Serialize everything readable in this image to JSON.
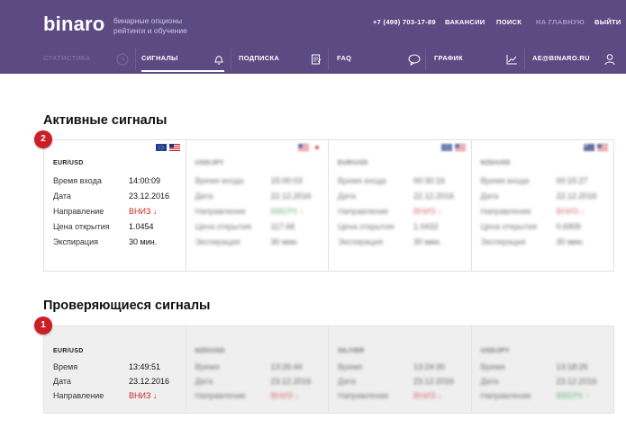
{
  "header": {
    "logo": "binaro",
    "tagline": "бинарные опционы рейтинги и обучение",
    "phone": "+7 (499) 703-17-89",
    "vacancies": "ВАКАНСИИ",
    "search": "ПОИСК",
    "home": "НА ГЛАВНУЮ",
    "logout": "ВЫЙТИ"
  },
  "nav": {
    "stats": "СТАТИСТИКА",
    "signals": "СИГНАЛЫ",
    "subscription": "ПОДПИСКА",
    "faq": "FAQ",
    "chart": "ГРАФИК",
    "user": "AE@BINARO.RU"
  },
  "active": {
    "title": "Активные сигналы",
    "badge": "2",
    "cards": [
      {
        "pair": "EUR/USD",
        "flags": [
          "eu",
          "us"
        ],
        "rows": [
          [
            "Время входа",
            "14:00:09",
            ""
          ],
          [
            "Дата",
            "23.12.2016",
            ""
          ],
          [
            "Направление",
            "ВНИЗ ↓",
            "down"
          ],
          [
            "Цена открытия",
            "1.0454",
            ""
          ],
          [
            "Экспирация",
            "30 мин.",
            ""
          ]
        ]
      },
      {
        "pair": "USD/JPY",
        "flags": [
          "us",
          "jp"
        ],
        "rows": [
          [
            "Время входа",
            "15:00:03",
            ""
          ],
          [
            "Дата",
            "22.12.2016",
            ""
          ],
          [
            "Направление",
            "ВВЕРХ ↑",
            "up"
          ],
          [
            "Цена открытия",
            "117.66",
            ""
          ],
          [
            "Экспирация",
            "30 мин.",
            ""
          ]
        ]
      },
      {
        "pair": "EUR/USD",
        "flags": [
          "eu",
          "us"
        ],
        "rows": [
          [
            "Время входа",
            "00:30:16",
            ""
          ],
          [
            "Дата",
            "22.12.2016",
            ""
          ],
          [
            "Направление",
            "ВНИЗ ↓",
            "down"
          ],
          [
            "Цена открытия",
            "1.0432",
            ""
          ],
          [
            "Экспирация",
            "30 мин.",
            ""
          ]
        ]
      },
      {
        "pair": "NZD/USD",
        "flags": [
          "nz",
          "us"
        ],
        "rows": [
          [
            "Время входа",
            "00:15:27",
            ""
          ],
          [
            "Дата",
            "22.12.2016",
            ""
          ],
          [
            "Направление",
            "ВНИЗ ↓",
            "down"
          ],
          [
            "Цена открытия",
            "0.6905",
            ""
          ],
          [
            "Экспирация",
            "30 мин.",
            ""
          ]
        ]
      }
    ]
  },
  "checking": {
    "title": "Проверяющиеся сигналы",
    "badge": "1",
    "cards": [
      {
        "pair": "EUR/USD",
        "rows": [
          [
            "Время",
            "13:49:51",
            ""
          ],
          [
            "Дата",
            "23.12.2016",
            ""
          ],
          [
            "Направление",
            "ВНИЗ ↓",
            "down"
          ]
        ]
      },
      {
        "pair": "NZD/USD",
        "rows": [
          [
            "Время",
            "13:26:44",
            ""
          ],
          [
            "Дата",
            "23.12.2016",
            ""
          ],
          [
            "Направление",
            "ВНИЗ ↓",
            "down"
          ]
        ]
      },
      {
        "pair": "SIL/VER",
        "rows": [
          [
            "Время",
            "13:24:30",
            ""
          ],
          [
            "Дата",
            "23.12.2016",
            ""
          ],
          [
            "Направление",
            "ВНИЗ ↓",
            "down"
          ]
        ]
      },
      {
        "pair": "USD/JPY",
        "rows": [
          [
            "Время",
            "13:18:26",
            ""
          ],
          [
            "Дата",
            "23.12.2016",
            ""
          ],
          [
            "Направление",
            "ВВЕРХ ↑",
            "up"
          ]
        ]
      }
    ]
  }
}
